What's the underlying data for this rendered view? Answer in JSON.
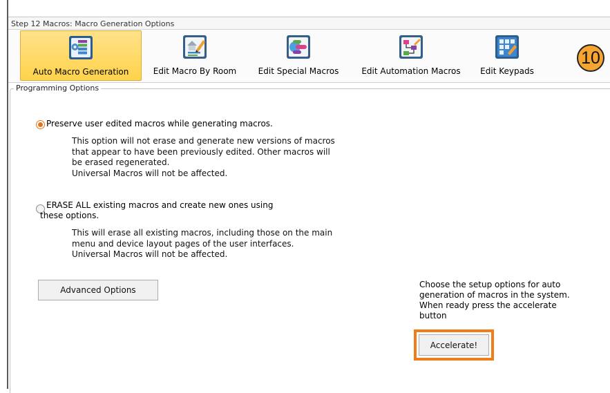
{
  "window": {
    "title": "Step 12 Macros: Macro Generation Options"
  },
  "ribbon": {
    "tabs": [
      {
        "label": "Auto Macro Generation",
        "icon": "auto-macro-icon",
        "active": true
      },
      {
        "label": "Edit Macro By Room",
        "icon": "room-macro-icon",
        "active": false
      },
      {
        "label": "Edit Special Macros",
        "icon": "special-macro-icon",
        "active": false
      },
      {
        "label": "Edit Automation Macros",
        "icon": "automation-macro-icon",
        "active": false
      },
      {
        "label": "Edit Keypads",
        "icon": "keypad-icon",
        "active": false
      }
    ]
  },
  "annotation": {
    "step_number": "10",
    "color": "#f7a532"
  },
  "programming": {
    "legend": "Programming Options",
    "options": [
      {
        "label": "Preserve user edited macros while generating macros.",
        "selected": true,
        "description": [
          "This option will not erase and generate new versions of macros",
          "that appear to have been previously edited. Other macros will",
          "be erased regenerated.",
          "Universal Macros will not be affected."
        ]
      },
      {
        "label_lines": [
          "ERASE ALL existing macros and create new ones using",
          "these options."
        ],
        "selected": false,
        "description": [
          "This will erase all existing macros, including those on the main",
          "menu and device layout pages of the user interfaces.",
          "Universal Macros will not be affected."
        ]
      }
    ],
    "advanced_button": "Advanced Options"
  },
  "help": {
    "lines": [
      "Choose the setup options for auto",
      "generation of macros in the system.",
      "When ready press the accelerate",
      "button"
    ]
  },
  "accelerate_button": "Accelerate!",
  "colors": {
    "highlight": "#f07d19",
    "active_tab": "#ffd34a",
    "radio_selected": "#e2751c"
  }
}
